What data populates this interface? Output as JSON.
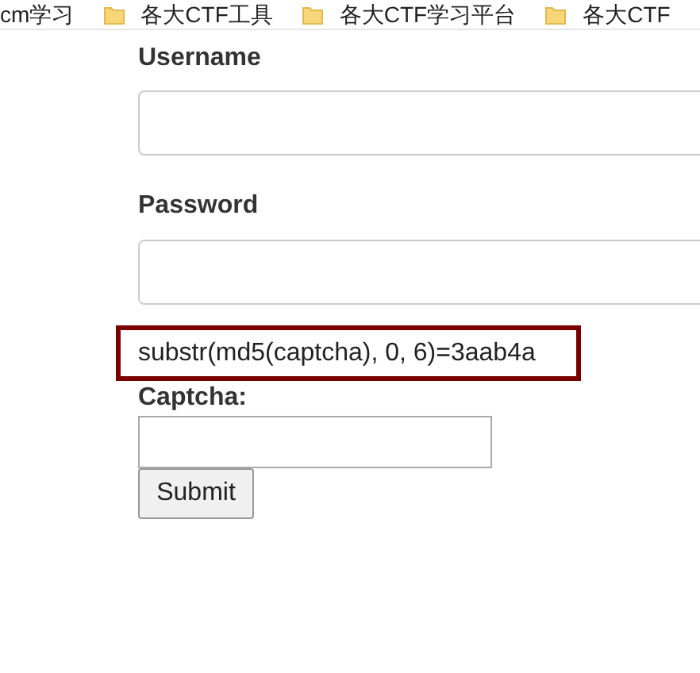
{
  "bookmarks": [
    {
      "label": "cm学习",
      "folder": false
    },
    {
      "label": "各大CTF工具",
      "folder": true
    },
    {
      "label": "各大CTF学习平台",
      "folder": true
    },
    {
      "label": "各大CTF",
      "folder": true
    }
  ],
  "form": {
    "username_label": "Username",
    "password_label": "Password",
    "hint": "substr(md5(captcha), 0, 6)=3aab4a",
    "captcha_label": "Captcha:",
    "submit": "Submit"
  }
}
